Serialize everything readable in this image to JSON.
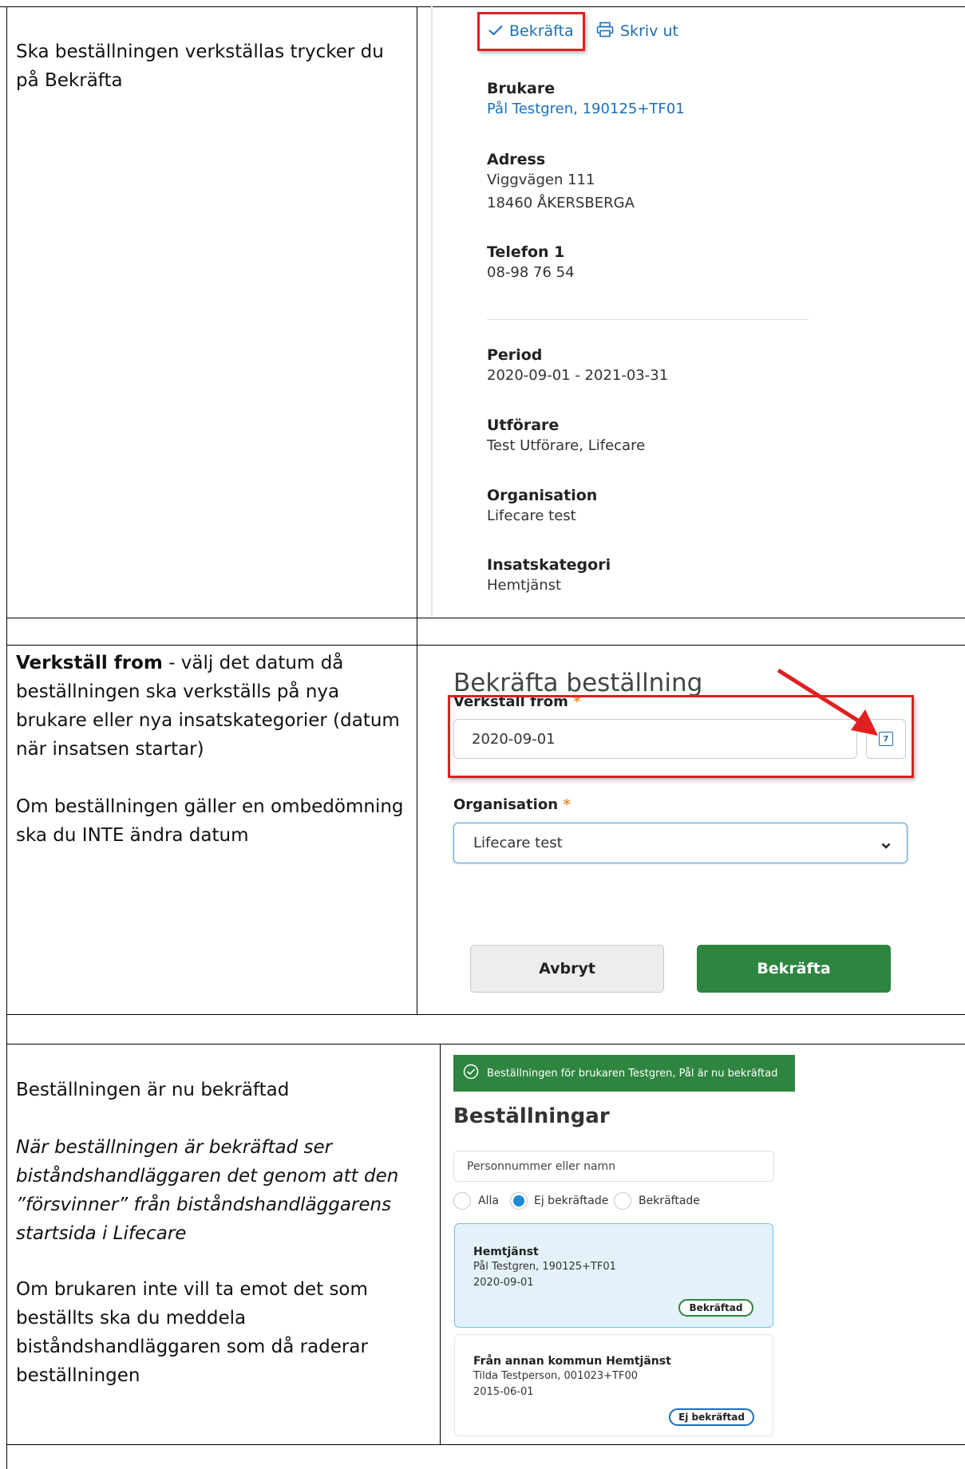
{
  "section1": {
    "instruction": "Ska beställningen verkställas trycker du på Bekräfta",
    "toolbar": {
      "confirm_label": "Bekräfta",
      "print_label": "Skriv ut"
    },
    "fields": [
      {
        "label": "Brukare",
        "value": "Pål Testgren, 190125+TF01"
      },
      {
        "label": "Adress",
        "line1": "Viggvägen 111",
        "line2": "18460 ÅKERSBERGA"
      },
      {
        "label": "Telefon 1",
        "value": "08-98 76 54"
      },
      {
        "label": "Period",
        "value": "2020-09-01 - 2021-03-31"
      },
      {
        "label": "Utförare",
        "value": "Test Utförare, Lifecare"
      },
      {
        "label": "Organisation",
        "value": "Lifecare test"
      },
      {
        "label": "Insatskategori",
        "value": "Hemtjänst"
      }
    ]
  },
  "section2": {
    "instruction_bold": "Verkställ from",
    "instruction_rest": " - välj det datum då beställningen ska verkställs på nya brukare eller nya insatskategorier (datum när insatsen startar)",
    "instruction2": "Om beställningen gäller en ombedömning ska du INTE ändra datum",
    "dialog_title": "Bekräfta beställning",
    "date_label": "Verkställ from",
    "date_value": "2020-09-01",
    "calendar_day": "7",
    "org_label": "Organisation",
    "org_value": "Lifecare test",
    "required_mark": "*",
    "cancel_label": "Avbryt",
    "confirm_label": "Bekräfta",
    "colors": {
      "primary": "#2e8540",
      "highlight": "#e02020"
    }
  },
  "section3": {
    "instruction1": "Beställningen är nu bekräftad",
    "instruction2": "När beställningen är bekräftad ser biståndshandläggaren det genom att den ”försvinner” från biståndshandläggarens startsida i Lifecare",
    "instruction3": "Om brukaren inte vill ta emot det som beställts ska du meddela biståndshandläggaren som då raderar beställningen",
    "toast": "Beställningen för brukaren Testgren, Pål är nu bekräftad",
    "heading": "Beställningar",
    "search_placeholder": "Personnummer eller namn",
    "filters": [
      {
        "label": "Alla",
        "selected": false
      },
      {
        "label": "Ej bekräftade",
        "selected": true
      },
      {
        "label": "Bekräftade",
        "selected": false
      }
    ],
    "orders": [
      {
        "title": "Hemtjänst",
        "person": "Pål Testgren, 190125+TF01",
        "date": "2020-09-01",
        "status": "Bekräftad"
      },
      {
        "title": "Från annan kommun Hemtjänst",
        "person": "Tilda Testperson, 001023+TF00",
        "date": "2015-06-01",
        "status": "Ej bekräftad"
      }
    ]
  }
}
